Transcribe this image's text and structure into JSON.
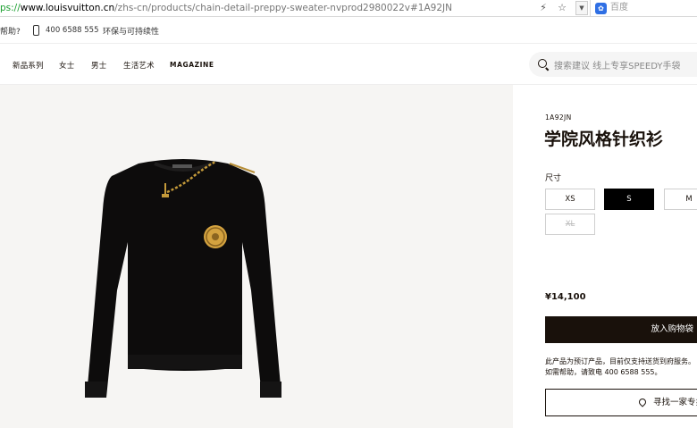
{
  "browser": {
    "url_scheme": "ps://",
    "url_host": "www.louisvuitton.cn",
    "url_path": "/zhs-cn/products/chain-detail-preppy-sweater-nvprod2980022v#1A92JN",
    "search_engine": "百度",
    "icons": [
      "bolt-icon",
      "star-icon",
      "chevron-down-icon",
      "paw-icon"
    ]
  },
  "util_bar": {
    "help": "帮助?",
    "phone": "400 6588 555",
    "sustainability": "环保与可持续性"
  },
  "nav": {
    "items": [
      "新品系列",
      "女士",
      "男士",
      "生活艺术",
      "MAGAZINE"
    ],
    "search_placeholder": "搜索建议  线上专享SPEEDY手袋"
  },
  "product": {
    "sku": "1A92JN",
    "title": "学院风格针织衫",
    "size_label": "尺寸",
    "sizes": [
      {
        "label": "XS",
        "state": "available"
      },
      {
        "label": "S",
        "state": "selected"
      },
      {
        "label": "M",
        "state": "available"
      },
      {
        "label": "XL",
        "state": "unavailable"
      }
    ],
    "price": "¥14,100",
    "add_to_cart": "放入购物袋",
    "note": "此产品为预订产品，目前仅支持送货到府服务。如需帮助，请致电 400 6588 555。",
    "find_store": "寻找一家专卖店"
  },
  "colors": {
    "text": "#19110b",
    "image_bg": "#f6f5f3",
    "selected_bg": "#000000",
    "url_scheme": "#1a9e2f"
  }
}
